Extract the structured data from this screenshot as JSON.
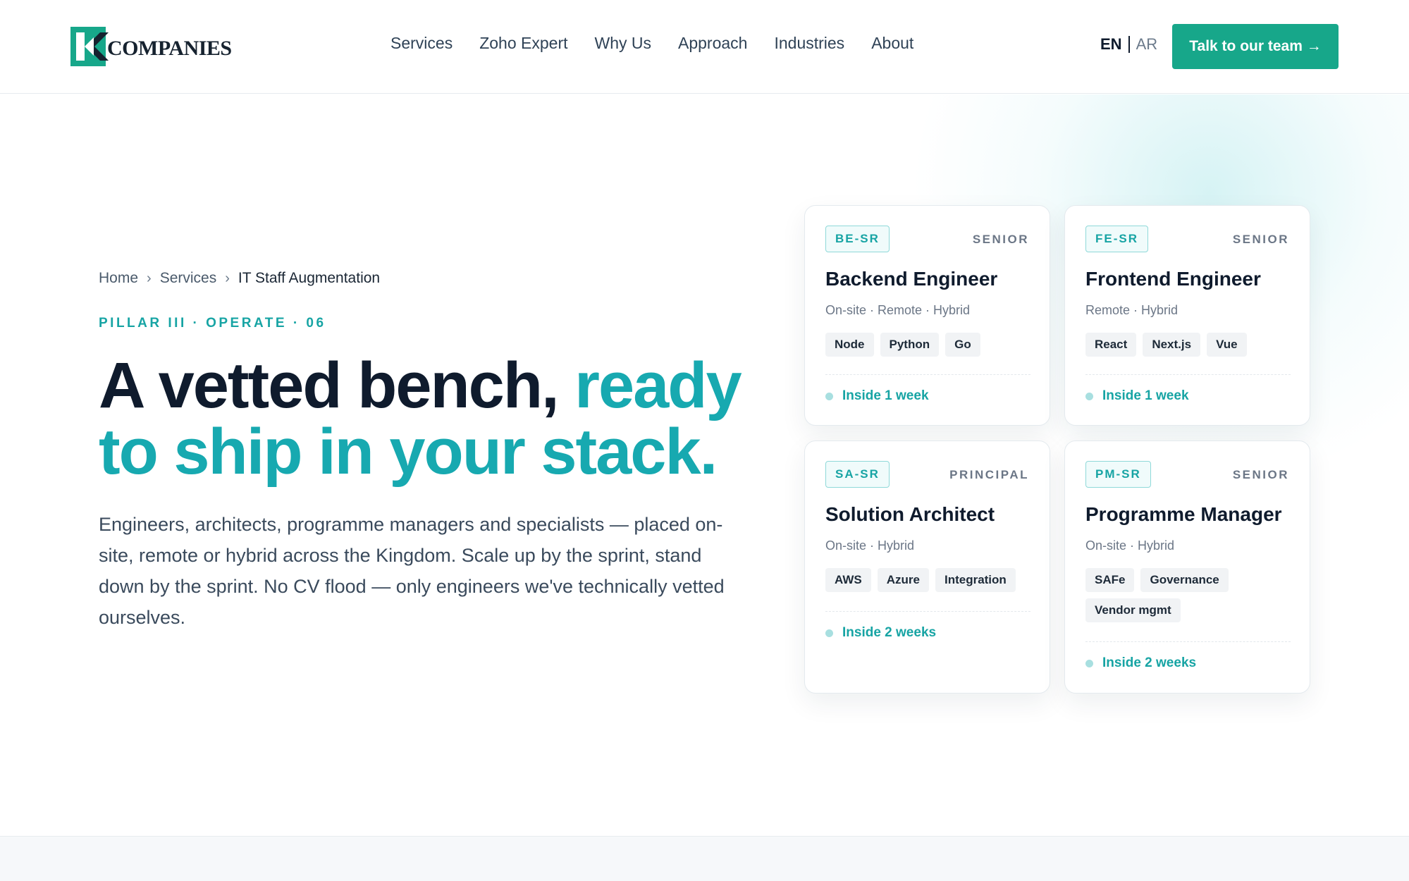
{
  "brand": {
    "logo_text": "COMPANIES",
    "colors": {
      "primary": "#17a78a",
      "accent": "#17a9b0",
      "dark": "#0f1b2d"
    }
  },
  "nav": {
    "items": [
      "Services",
      "Zoho Expert",
      "Why Us",
      "Approach",
      "Industries",
      "About"
    ]
  },
  "lang": {
    "en": "EN",
    "ar": "AR"
  },
  "cta": {
    "label": "Talk to our team →"
  },
  "breadcrumb": {
    "home": "Home",
    "services": "Services",
    "current": "IT Staff Augmentation"
  },
  "hero": {
    "kicker": "PILLAR III · OPERATE · 06",
    "headline_plain": "A vetted bench, ",
    "headline_accent": "ready to ship in your stack.",
    "lead": "Engineers, architects, programme managers and specialists — placed on-site, remote or hybrid across the Kingdom. Scale up by the sprint, stand down by the sprint. No CV flood — only engineers we've technically vetted ourselves."
  },
  "cards": [
    {
      "code": "BE-SR",
      "level": "SENIOR",
      "title": "Backend Engineer",
      "modes": "On-site · Remote · Hybrid",
      "tags": [
        "Node",
        "Python",
        "Go"
      ],
      "eta": "Inside 1 week"
    },
    {
      "code": "FE-SR",
      "level": "SENIOR",
      "title": "Frontend Engineer",
      "modes": "Remote · Hybrid",
      "tags": [
        "React",
        "Next.js",
        "Vue"
      ],
      "eta": "Inside 1 week"
    },
    {
      "code": "SA-SR",
      "level": "PRINCIPAL",
      "title": "Solution Architect",
      "modes": "On-site · Hybrid",
      "tags": [
        "AWS",
        "Azure",
        "Integration"
      ],
      "eta": "Inside 2 weeks"
    },
    {
      "code": "PM-SR",
      "level": "SENIOR",
      "title": "Programme Manager",
      "modes": "On-site · Hybrid",
      "tags": [
        "SAFe",
        "Governance",
        "Vendor mgmt"
      ],
      "eta": "Inside 2 weeks"
    }
  ]
}
